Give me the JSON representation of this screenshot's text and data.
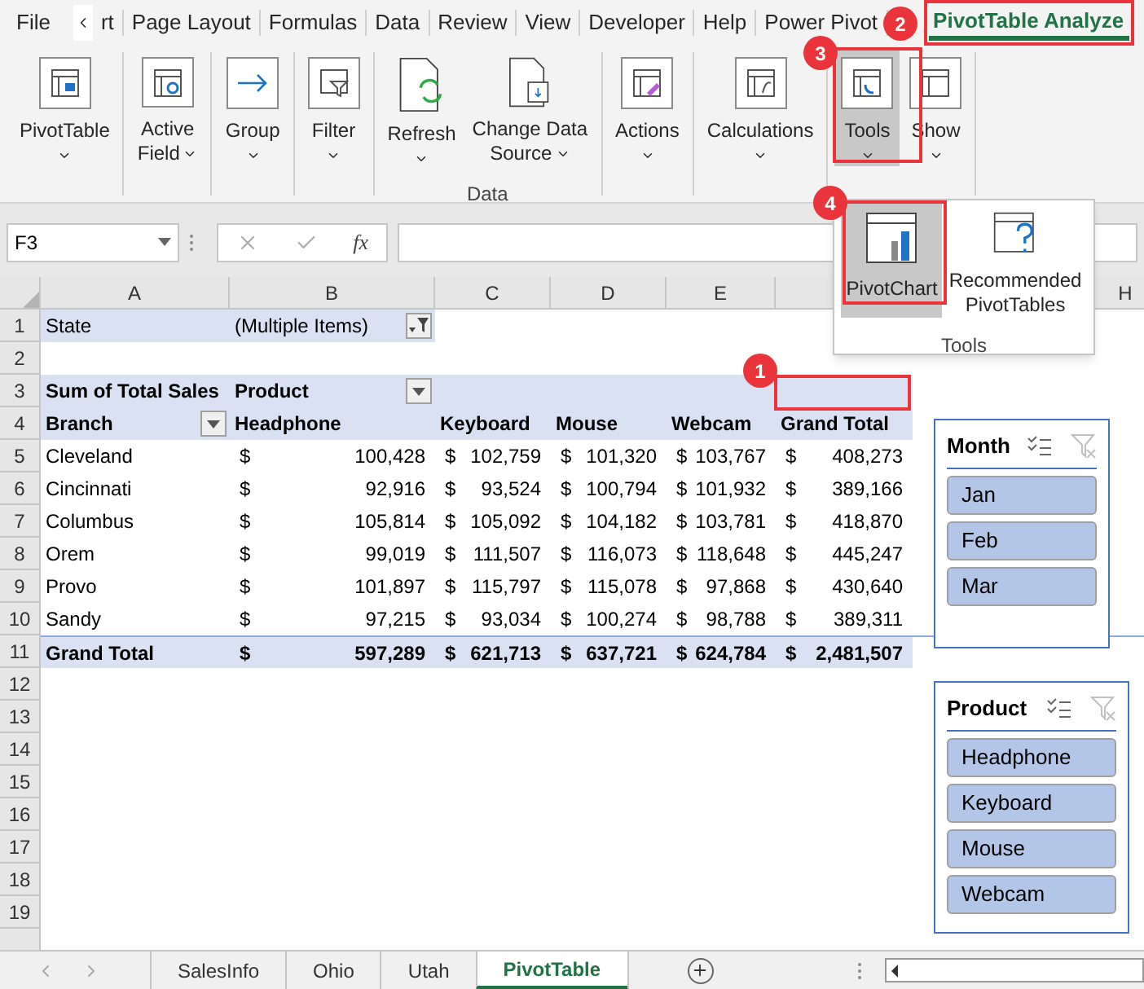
{
  "menu_tabs": [
    {
      "label": "File",
      "selected": false
    },
    {
      "label": "rt",
      "selected": false
    },
    {
      "label": "Page Layout",
      "selected": false
    },
    {
      "label": "Formulas",
      "selected": false
    },
    {
      "label": "Data",
      "selected": false
    },
    {
      "label": "Review",
      "selected": false
    },
    {
      "label": "View",
      "selected": false
    },
    {
      "label": "Developer",
      "selected": false
    },
    {
      "label": "Help",
      "selected": false
    },
    {
      "label": "Power Pivot",
      "selected": false
    },
    {
      "label": "PivotTable Analyze",
      "selected": true
    }
  ],
  "ribbon_groups": [
    {
      "buttons": [
        {
          "lines": [
            "PivotTable"
          ],
          "dropdown": true,
          "selected": false
        }
      ]
    },
    {
      "buttons": [
        {
          "lines": [
            "Active",
            "Field"
          ],
          "dropdown": true,
          "selected": false
        }
      ]
    },
    {
      "buttons": [
        {
          "lines": [
            "Group"
          ],
          "dropdown": true,
          "selected": false
        }
      ]
    },
    {
      "buttons": [
        {
          "lines": [
            "Filter"
          ],
          "dropdown": true,
          "selected": false
        }
      ]
    },
    {
      "label": "Data",
      "buttons": [
        {
          "lines": [
            "Refresh"
          ],
          "dropdown": true,
          "selected": false
        },
        {
          "lines": [
            "Change Data",
            "Source"
          ],
          "dropdown": true,
          "selected": false
        }
      ]
    },
    {
      "buttons": [
        {
          "lines": [
            "Actions"
          ],
          "dropdown": true,
          "selected": false
        }
      ]
    },
    {
      "buttons": [
        {
          "lines": [
            "Calculations"
          ],
          "dropdown": true,
          "selected": false
        }
      ]
    },
    {
      "buttons": [
        {
          "lines": [
            "Tools"
          ],
          "dropdown": true,
          "selected": true
        },
        {
          "lines": [
            "Show"
          ],
          "dropdown": true,
          "selected": false
        }
      ]
    }
  ],
  "tools_menu": {
    "label": "Tools",
    "items": [
      {
        "lines": [
          "PivotChart"
        ],
        "selected": true
      },
      {
        "lines": [
          "Recommended",
          "PivotTables"
        ],
        "selected": false
      }
    ]
  },
  "formula_bar": {
    "name_box": "F3",
    "function_label": "fx"
  },
  "column_headers": [
    "A",
    "B",
    "C",
    "D",
    "E",
    "H"
  ],
  "rows": [
    {
      "number": "1",
      "kind": "filter",
      "cells": [
        {
          "kind": "text",
          "text": "State"
        },
        {
          "kind": "text",
          "text": "(Multiple Items)",
          "filter_applied": true
        }
      ]
    },
    {
      "number": "2",
      "kind": "body",
      "cells": []
    },
    {
      "number": "3",
      "kind": "header",
      "cells": [
        {
          "kind": "text",
          "text": "Sum of Total Sales"
        },
        {
          "kind": "text",
          "text": "Product",
          "dropdown": true
        }
      ]
    },
    {
      "number": "4",
      "kind": "header",
      "cells": [
        {
          "kind": "text",
          "text": "Branch",
          "dropdown": true
        },
        {
          "kind": "text",
          "text": "Headphone"
        },
        {
          "kind": "text",
          "text": "Keyboard"
        },
        {
          "kind": "text",
          "text": "Mouse"
        },
        {
          "kind": "text",
          "text": "Webcam"
        },
        {
          "kind": "text",
          "text": "Grand Total"
        }
      ]
    },
    {
      "number": "5",
      "kind": "body",
      "cells": [
        {
          "kind": "text",
          "text": "Cleveland"
        },
        {
          "kind": "money",
          "symbol": "$",
          "amount": "100,428"
        },
        {
          "kind": "money",
          "symbol": "$",
          "amount": "102,759"
        },
        {
          "kind": "money",
          "symbol": "$",
          "amount": "101,320"
        },
        {
          "kind": "money",
          "symbol": "$",
          "amount": "103,767"
        },
        {
          "kind": "money",
          "symbol": "$",
          "amount": "408,273"
        }
      ]
    },
    {
      "number": "6",
      "kind": "body",
      "cells": [
        {
          "kind": "text",
          "text": "Cincinnati"
        },
        {
          "kind": "money",
          "symbol": "$",
          "amount": "92,916"
        },
        {
          "kind": "money",
          "symbol": "$",
          "amount": "93,524"
        },
        {
          "kind": "money",
          "symbol": "$",
          "amount": "100,794"
        },
        {
          "kind": "money",
          "symbol": "$",
          "amount": "101,932"
        },
        {
          "kind": "money",
          "symbol": "$",
          "amount": "389,166"
        }
      ]
    },
    {
      "number": "7",
      "kind": "body",
      "cells": [
        {
          "kind": "text",
          "text": "Columbus"
        },
        {
          "kind": "money",
          "symbol": "$",
          "amount": "105,814"
        },
        {
          "kind": "money",
          "symbol": "$",
          "amount": "105,092"
        },
        {
          "kind": "money",
          "symbol": "$",
          "amount": "104,182"
        },
        {
          "kind": "money",
          "symbol": "$",
          "amount": "103,781"
        },
        {
          "kind": "money",
          "symbol": "$",
          "amount": "418,870"
        }
      ]
    },
    {
      "number": "8",
      "kind": "body",
      "cells": [
        {
          "kind": "text",
          "text": "Orem"
        },
        {
          "kind": "money",
          "symbol": "$",
          "amount": "99,019"
        },
        {
          "kind": "money",
          "symbol": "$",
          "amount": "111,507"
        },
        {
          "kind": "money",
          "symbol": "$",
          "amount": "116,073"
        },
        {
          "kind": "money",
          "symbol": "$",
          "amount": "118,648"
        },
        {
          "kind": "money",
          "symbol": "$",
          "amount": "445,247"
        }
      ]
    },
    {
      "number": "9",
      "kind": "body",
      "cells": [
        {
          "kind": "text",
          "text": "Provo"
        },
        {
          "kind": "money",
          "symbol": "$",
          "amount": "101,897"
        },
        {
          "kind": "money",
          "symbol": "$",
          "amount": "115,797"
        },
        {
          "kind": "money",
          "symbol": "$",
          "amount": "115,078"
        },
        {
          "kind": "money",
          "symbol": "$",
          "amount": "97,868"
        },
        {
          "kind": "money",
          "symbol": "$",
          "amount": "430,640"
        }
      ]
    },
    {
      "number": "10",
      "kind": "body",
      "cells": [
        {
          "kind": "text",
          "text": "Sandy"
        },
        {
          "kind": "money",
          "symbol": "$",
          "amount": "97,215"
        },
        {
          "kind": "money",
          "symbol": "$",
          "amount": "93,034"
        },
        {
          "kind": "money",
          "symbol": "$",
          "amount": "100,274"
        },
        {
          "kind": "money",
          "symbol": "$",
          "amount": "98,788"
        },
        {
          "kind": "money",
          "symbol": "$",
          "amount": "389,311"
        }
      ]
    },
    {
      "number": "11",
      "kind": "total",
      "cells": [
        {
          "kind": "text",
          "text": "Grand Total"
        },
        {
          "kind": "money",
          "symbol": "$",
          "amount": "597,289"
        },
        {
          "kind": "money",
          "symbol": "$",
          "amount": "621,713"
        },
        {
          "kind": "money",
          "symbol": "$",
          "amount": "637,721"
        },
        {
          "kind": "money",
          "symbol": "$",
          "amount": "624,784"
        },
        {
          "kind": "money",
          "symbol": "$",
          "amount": "2,481,507"
        }
      ]
    },
    {
      "number": "12",
      "kind": "body",
      "cells": []
    },
    {
      "number": "13",
      "kind": "body",
      "cells": []
    },
    {
      "number": "14",
      "kind": "body",
      "cells": []
    },
    {
      "number": "15",
      "kind": "body",
      "cells": []
    },
    {
      "number": "16",
      "kind": "body",
      "cells": []
    },
    {
      "number": "17",
      "kind": "body",
      "cells": []
    },
    {
      "number": "18",
      "kind": "body",
      "cells": []
    },
    {
      "number": "19",
      "kind": "body",
      "cells": []
    }
  ],
  "slicers": [
    {
      "title": "Month",
      "clear_filter_disabled": true,
      "items": [
        {
          "label": "Jan",
          "selected": true
        },
        {
          "label": "Feb",
          "selected": true
        },
        {
          "label": "Mar",
          "selected": true
        }
      ]
    },
    {
      "title": "Product",
      "clear_filter_disabled": true,
      "items": [
        {
          "label": "Headphone",
          "selected": true
        },
        {
          "label": "Keyboard",
          "selected": true
        },
        {
          "label": "Mouse",
          "selected": true
        },
        {
          "label": "Webcam",
          "selected": true
        }
      ]
    }
  ],
  "sheet_tabs": [
    {
      "label": "SalesInfo",
      "selected": false
    },
    {
      "label": "Ohio",
      "selected": false
    },
    {
      "label": "Utah",
      "selected": false
    },
    {
      "label": "PivotTable",
      "selected": true
    }
  ],
  "callouts": [
    {
      "number": "1"
    },
    {
      "number": "2"
    },
    {
      "number": "3"
    },
    {
      "number": "4"
    }
  ]
}
